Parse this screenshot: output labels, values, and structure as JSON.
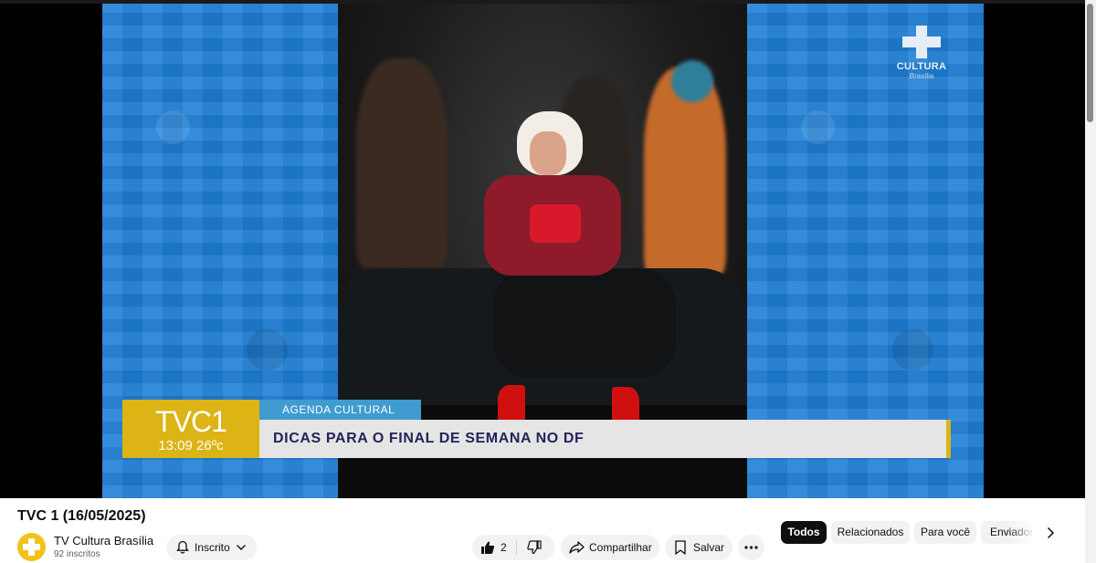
{
  "video": {
    "title": "TVC 1 (16/05/2025)",
    "overlay": {
      "channel_logo_text": "CULTURA",
      "channel_logo_sub": "Brasília",
      "program_brand": "TVC1",
      "time_temp": "13:09 26ºc",
      "section_tag": "AGENDA CULTURAL",
      "headline": "DICAS PARA O FINAL DE SEMANA NO DF"
    },
    "colors": {
      "brand_yellow": "#dcb415",
      "tag_blue": "#3f9bd0",
      "panel_blue": "#1f7fd6"
    }
  },
  "channel": {
    "name": "TV Cultura Brasília",
    "subscribers": "92 inscritos",
    "avatar_icon": "cross-logo-icon"
  },
  "actions": {
    "subscribe_label": "Inscrito",
    "like_count": "2",
    "share_label": "Compartilhar",
    "save_label": "Salvar",
    "icons": [
      "bell-icon",
      "chevron-down-icon",
      "thumb-up-icon",
      "thumb-down-icon",
      "share-icon",
      "bookmark-icon",
      "more-icon"
    ]
  },
  "chips": {
    "items": [
      "Todos",
      "Relacionados",
      "Para você",
      "Enviados"
    ],
    "selected": "Todos",
    "next_icon": "chevron-right-icon"
  }
}
